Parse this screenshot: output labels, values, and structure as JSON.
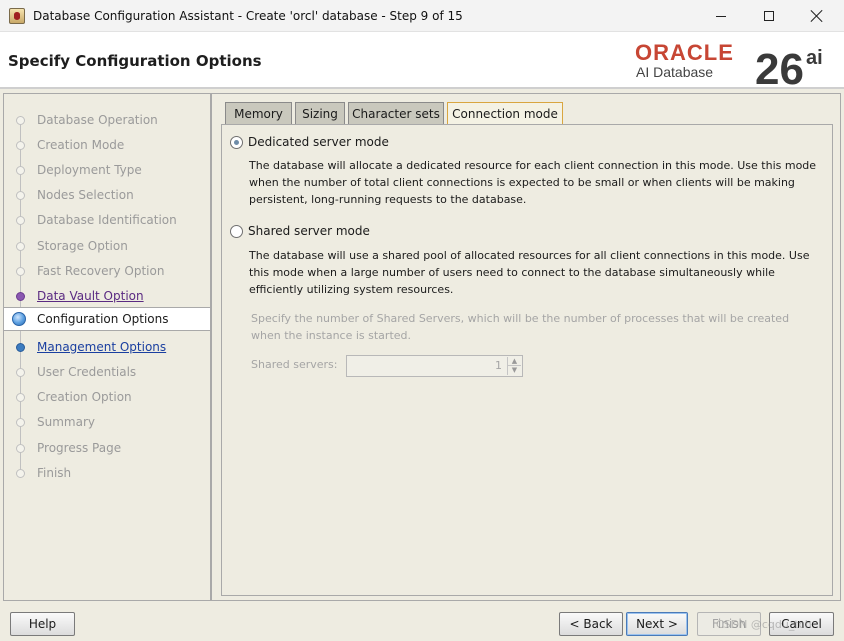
{
  "window": {
    "title": "Database Configuration Assistant - Create 'orcl' database - Step 9 of 15",
    "app_icon": "dbca-app-icon",
    "controls": [
      "minimize-icon",
      "maximize-icon",
      "close-icon"
    ]
  },
  "header": {
    "title": "Specify Configuration Options",
    "brand": {
      "name": "ORACLE",
      "subtitle": "AI Database",
      "version": "26",
      "version_suffix": "ai",
      "brand_color": "#c74634"
    }
  },
  "steps": [
    {
      "label": "Database Operation",
      "state": "disabled"
    },
    {
      "label": "Creation Mode",
      "state": "disabled"
    },
    {
      "label": "Deployment Type",
      "state": "disabled"
    },
    {
      "label": "Nodes Selection",
      "state": "disabled"
    },
    {
      "label": "Database Identification",
      "state": "disabled"
    },
    {
      "label": "Storage Option",
      "state": "disabled"
    },
    {
      "label": "Fast Recovery Option",
      "state": "disabled"
    },
    {
      "label": "Data Vault Option",
      "state": "visited"
    },
    {
      "label": "Configuration Options",
      "state": "current"
    },
    {
      "label": "Management Options",
      "state": "link"
    },
    {
      "label": "User Credentials",
      "state": "disabled"
    },
    {
      "label": "Creation Option",
      "state": "disabled"
    },
    {
      "label": "Summary",
      "state": "disabled"
    },
    {
      "label": "Progress Page",
      "state": "disabled"
    },
    {
      "label": "Finish",
      "state": "disabled"
    }
  ],
  "tabs": [
    {
      "label": "Memory",
      "selected": false
    },
    {
      "label": "Sizing",
      "selected": false
    },
    {
      "label": "Character sets",
      "selected": false
    },
    {
      "label": "Connection mode",
      "selected": true
    }
  ],
  "connection_mode": {
    "dedicated": {
      "label": "Dedicated server mode",
      "checked": true,
      "description": "The database will allocate a dedicated resource for each client connection in this mode. Use this mode when the number of total client connections is expected to be small or when clients will be making persistent, long-running requests to the database."
    },
    "shared": {
      "label": "Shared server mode",
      "checked": false,
      "description": "The database will use a shared pool of allocated resources for all client connections in this mode.  Use this mode when a large number of users need to connect to the database simultaneously while efficiently utilizing system resources.",
      "servers_hint": "Specify the number of Shared Servers, which will be the number of processes that will be created when the instance is started.",
      "servers_label": "Shared servers:",
      "servers_value": "1"
    }
  },
  "buttons": {
    "help": "Help",
    "back": "< Back",
    "next": "Next >",
    "finish": "Finish",
    "cancel": "Cancel"
  },
  "watermark": "CSDN @cqdu_tch",
  "colors": {
    "panel_bg": "#eeece1",
    "selected_tab_border": "#d9a640",
    "link_blue": "#1a3fa0",
    "visited_purple": "#5a2a82"
  }
}
